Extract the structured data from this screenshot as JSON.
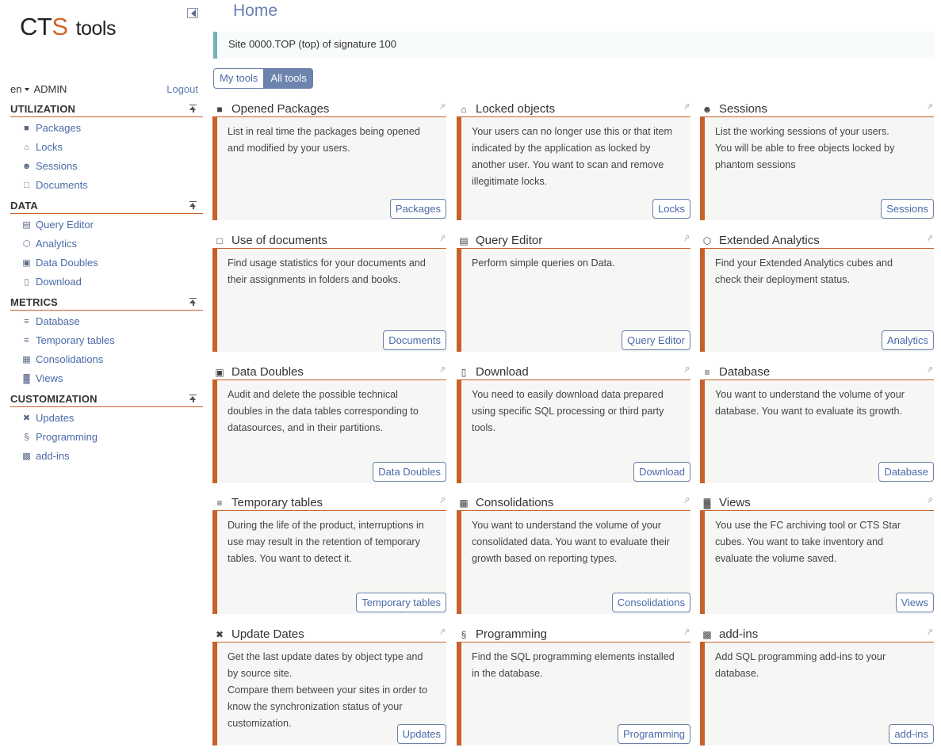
{
  "logo": {
    "part1": "CT",
    "part2": "S",
    "part3": "tools"
  },
  "user": {
    "lang": "en",
    "name": "ADMIN",
    "logout": "Logout"
  },
  "sidebar": {
    "sections": [
      {
        "title": "UTILIZATION",
        "items": [
          {
            "label": "Packages",
            "icon": "briefcase-icon"
          },
          {
            "label": "Locks",
            "icon": "lock-icon"
          },
          {
            "label": "Sessions",
            "icon": "users-icon"
          },
          {
            "label": "Documents",
            "icon": "book-icon"
          }
        ]
      },
      {
        "title": "DATA",
        "items": [
          {
            "label": "Query Editor",
            "icon": "query-icon"
          },
          {
            "label": "Analytics",
            "icon": "cube-icon"
          },
          {
            "label": "Data Doubles",
            "icon": "cubes-icon"
          },
          {
            "label": "Download",
            "icon": "file-icon"
          }
        ]
      },
      {
        "title": "METRICS",
        "items": [
          {
            "label": "Database",
            "icon": "database-icon"
          },
          {
            "label": "Temporary tables",
            "icon": "database-icon"
          },
          {
            "label": "Consolidations",
            "icon": "consolidation-icon"
          },
          {
            "label": "Views",
            "icon": "views-icon"
          }
        ]
      },
      {
        "title": "CUSTOMIZATION",
        "items": [
          {
            "label": "Updates",
            "icon": "tools-icon"
          },
          {
            "label": "Programming",
            "icon": "script-icon"
          },
          {
            "label": "add-ins",
            "icon": "puzzle-icon"
          }
        ]
      }
    ]
  },
  "main": {
    "title": "Home",
    "banner": "Site 0000.TOP (top) of signature 100",
    "toggle": {
      "my": "My tools",
      "all": "All tools"
    },
    "cards": [
      {
        "title": "Opened Packages",
        "icon": "briefcase-icon",
        "desc": "List in real time the packages being opened\nand modified by your users.",
        "button": "Packages"
      },
      {
        "title": "Locked objects",
        "icon": "lock-icon",
        "desc": "Your users can no longer use this or that item\nindicated by the application as locked by\nanother user. You want to scan and remove\nillegitimate locks.",
        "button": "Locks"
      },
      {
        "title": "Sessions",
        "icon": "users-icon",
        "desc": "List the working sessions of your users.\nYou will be able to free objects locked by\nphantom sessions",
        "button": "Sessions"
      },
      {
        "title": "Use of documents",
        "icon": "book-icon",
        "desc": "Find usage statistics for your documents and\ntheir assignments in folders and books.",
        "button": "Documents"
      },
      {
        "title": "Query Editor",
        "icon": "query-icon",
        "desc": "Perform simple queries on Data.",
        "button": "Query Editor"
      },
      {
        "title": "Extended Analytics",
        "icon": "cube-icon",
        "desc": "Find your Extended Analytics cubes and\ncheck their deployment status.",
        "button": "Analytics"
      },
      {
        "title": "Data Doubles",
        "icon": "cubes-icon",
        "desc": "Audit and delete the possible technical\ndoubles in the data tables corresponding to\ndatasources, and in their partitions.",
        "button": "Data Doubles"
      },
      {
        "title": "Download",
        "icon": "file-icon",
        "desc": "You need to easily download data prepared\nusing specific SQL processing or third party\ntools.",
        "button": "Download"
      },
      {
        "title": "Database",
        "icon": "database-icon",
        "desc": "You want to understand the volume of your\ndatabase. You want to evaluate its growth.",
        "button": "Database"
      },
      {
        "title": "Temporary tables",
        "icon": "database-icon",
        "desc": "During the life of the product, interruptions in\nuse may result in the retention of temporary\ntables. You want to detect it.",
        "button": "Temporary tables"
      },
      {
        "title": "Consolidations",
        "icon": "consolidation-icon",
        "desc": "You want to understand the volume of your\nconsolidated data. You want to evaluate their\ngrowth based on reporting types.",
        "button": "Consolidations"
      },
      {
        "title": "Views",
        "icon": "views-icon",
        "desc": "You use the FC archiving tool or CTS Star\ncubes. You want to take inventory and\nevaluate the volume saved.",
        "button": "Views"
      },
      {
        "title": "Update Dates",
        "icon": "tools-icon",
        "desc": "Get the last update dates by object type and\nby source site.\nCompare them between your sites in order to\nknow the synchronization status of your\ncustomization.",
        "button": "Updates"
      },
      {
        "title": "Programming",
        "icon": "script-icon",
        "desc": "Find the SQL programming elements installed\nin the database.",
        "button": "Programming"
      },
      {
        "title": "add-ins",
        "icon": "puzzle-icon",
        "desc": "Add SQL programming add-ins to your\ndatabase.",
        "button": "add-ins"
      }
    ]
  },
  "colors": {
    "accent": "#c8602a",
    "link": "#4a6aa8",
    "active_toggle": "#6d84ae",
    "banner_border": "#7ab0b5"
  }
}
